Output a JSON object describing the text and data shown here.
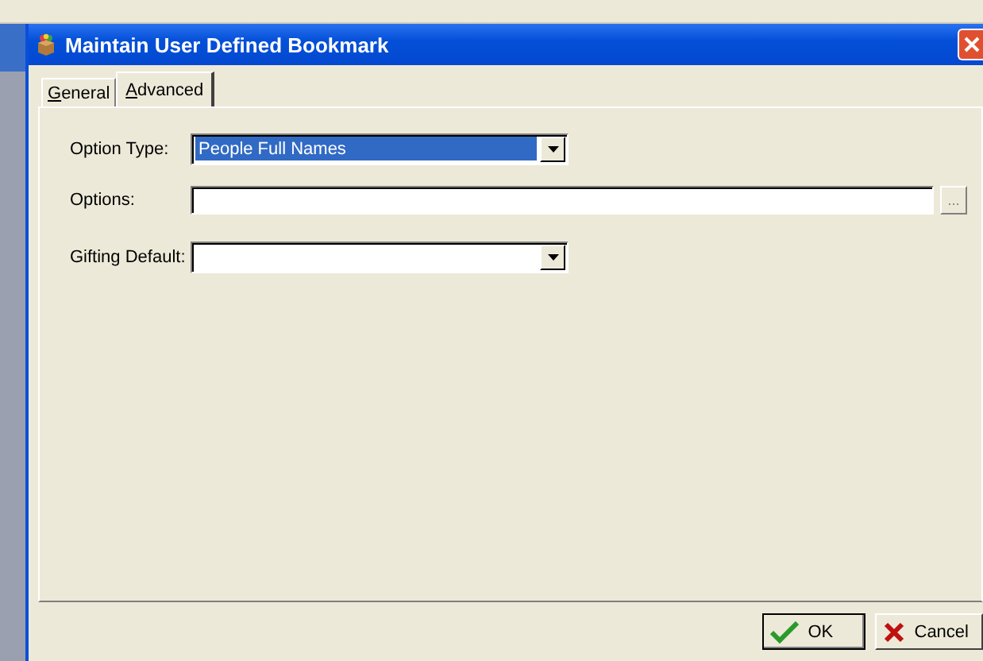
{
  "window": {
    "title": "Maintain User Defined Bookmark"
  },
  "tabs": [
    {
      "label": "General",
      "selected": false
    },
    {
      "label": "Advanced",
      "selected": true
    }
  ],
  "fields": [
    {
      "kind": "dropdown",
      "label": "Option Type:",
      "value": "People Full Names",
      "focused": true
    },
    {
      "kind": "browse",
      "label": "Options:",
      "browse_label": "..."
    },
    {
      "kind": "dropdown",
      "label": "Gifting Default:",
      "focused": false
    }
  ],
  "buttons": [
    {
      "kind": "ok",
      "label": "OK"
    },
    {
      "kind": "cancel",
      "label": "Cancel"
    }
  ]
}
